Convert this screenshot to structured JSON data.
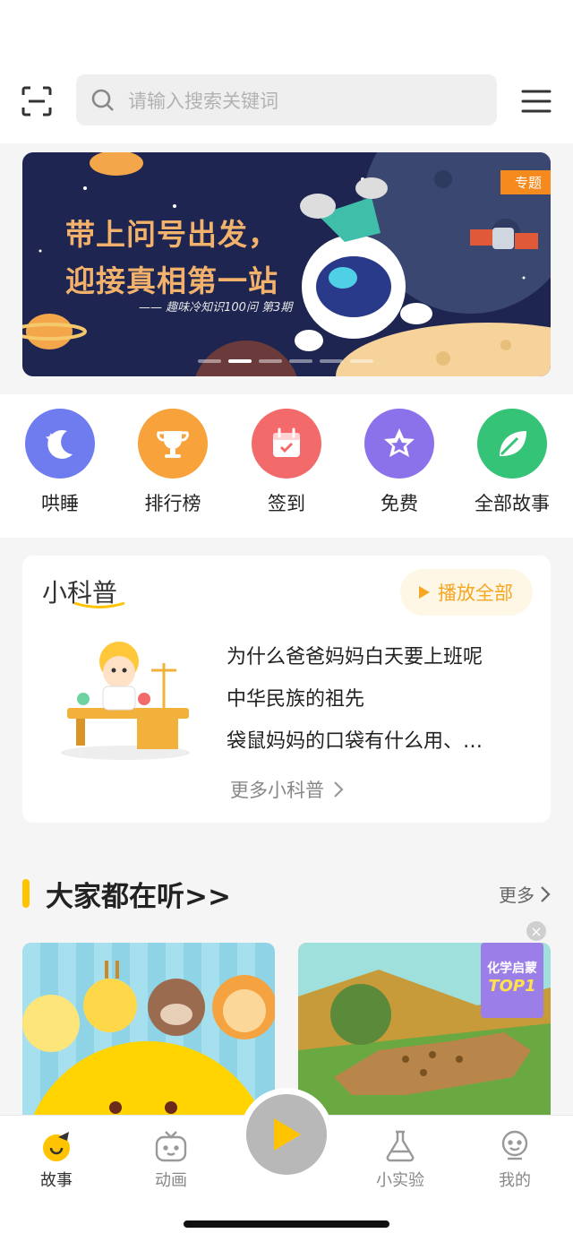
{
  "header": {
    "search_placeholder": "请输入搜索关键词",
    "scan_icon": "scan-icon",
    "menu_icon": "menu-icon"
  },
  "banner": {
    "title_line1": "带上问号出发，",
    "title_line2": "迎接真相第一站",
    "subtitle": "—— 趣味冷知识100问  第3期",
    "tag": "专题",
    "pages": 6,
    "active_page": 2
  },
  "quick_entries": [
    {
      "label": "哄睡",
      "icon": "moon-icon",
      "color": "#6f7cf0"
    },
    {
      "label": "排行榜",
      "icon": "trophy-icon",
      "color": "#f7a23b"
    },
    {
      "label": "签到",
      "icon": "calendar-icon",
      "color": "#f36a6a"
    },
    {
      "label": "免费",
      "icon": "star-icon",
      "color": "#8c72ea"
    },
    {
      "label": "全部故事",
      "icon": "leaf-icon",
      "color": "#35c377"
    }
  ],
  "kepu": {
    "title": "小科普",
    "play_all": "播放全部",
    "items": [
      "为什么爸爸妈妈白天要上班呢",
      "中华民族的祖先",
      "袋鼠妈妈的口袋有什么用、…"
    ],
    "more": "更多小科普"
  },
  "listening": {
    "title": "大家都在听>>",
    "more": "更多",
    "badge_line1": "化学启蒙",
    "badge_line2": "TOP1",
    "close": "×"
  },
  "tabbar": {
    "tabs": [
      {
        "label": "故事",
        "icon": "story-icon"
      },
      {
        "label": "动画",
        "icon": "tv-icon"
      },
      {
        "label": "小实验",
        "icon": "flask-icon"
      },
      {
        "label": "我的",
        "icon": "profile-icon"
      }
    ],
    "active": "故事",
    "center_icon": "play-icon"
  },
  "colors": {
    "accent": "#ffc300",
    "orange": "#f5a623"
  }
}
